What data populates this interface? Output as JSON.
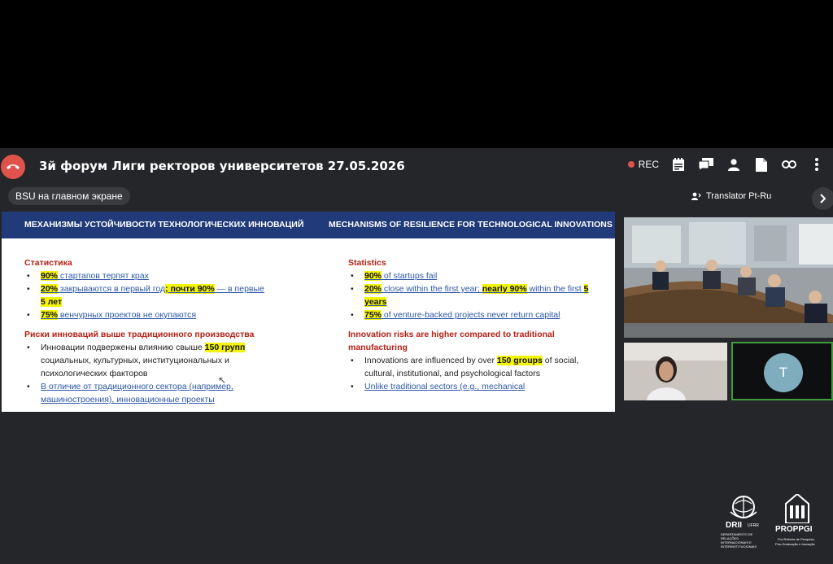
{
  "meeting": {
    "title": "3й форум Лиги ректоров университетов 27.05.2026",
    "rec_label": "REC",
    "screen_share_label": "BSU на главном экране",
    "translator_label": "Translator Pt-Ru"
  },
  "colors": {
    "hangup": "#e0534d",
    "slide_header": "#203a7a",
    "highlight": "#f4f40a",
    "active_speaker_border": "#3f9a3c",
    "avatar": "#7fadbd"
  },
  "icons": [
    "phone-hangup-icon",
    "record-icon",
    "notes-icon",
    "chat-icon",
    "participants-icon",
    "document-icon",
    "link-icon",
    "chevron-right-icon",
    "headset-icon"
  ],
  "slide": {
    "left": {
      "header": "МЕХАНИЗМЫ УСТОЙЧИВОСТИ ТЕХНОЛОГИЧЕСКИХ ИННОВАЦИЙ",
      "s1_heading": "Статистика",
      "b1_hl": "90%",
      "b1_rest": " стартапов терпят крах",
      "b2_hl1": "20%",
      "b2_mid": " закрываются в первый год",
      "b2_hl2": "; почти 90%",
      "b2_rest": " — в первые",
      "b2_hl3": "5 лет",
      "b3_hl": "75%",
      "b3_rest": " венчурных проектов не окупаются",
      "s2_heading": "Риски инноваций выше традиционного производства",
      "b4_pre": "Инновации подвержены влиянию свыше ",
      "b4_hl": "150 групп",
      "b4_rest": "социальных, культурных, институциональных и психологических факторов",
      "b5": "В отличие от традиционного сектора (например, машиностроения), инновационные проекты"
    },
    "right": {
      "header": "MECHANISMS OF RESILIENCE FOR TECHNOLOGICAL INNOVATIONS",
      "s1_heading": "Statistics",
      "b1_hl": "90%",
      "b1_rest": " of startups fail",
      "b2_hl1": "20%",
      "b2_mid": " close within the first year; ",
      "b2_hl2": "nearly 90%",
      "b2_rest": " within the first ",
      "b2_hl3": "5 years",
      "b3_hl": "75%",
      "b3_rest": " of venture-backed projects never return capital",
      "s2_heading": "Innovation risks are higher compared to traditional manufacturing",
      "b4_pre": "Innovations are influenced by over ",
      "b4_hl": "150 groups",
      "b4_rest": " of social, cultural, institutional, and psychological factors",
      "b5": "Unlike traditional sectors (e.g., mechanical"
    }
  },
  "participants": {
    "t_initial": "T"
  },
  "logos": {
    "drii": "DRII",
    "drii_sub": "UFRR",
    "drii_caption": "DEPARTAMENTO DE RELAÇÕES INTERNACIONAIS E INTERINSTITUCIONAIS",
    "proppgi": "PROPPGI",
    "proppgi_caption1": "Pró-Reitoria de Pesquisa,",
    "proppgi_caption2": "Pós-Graduação e Inovação"
  }
}
